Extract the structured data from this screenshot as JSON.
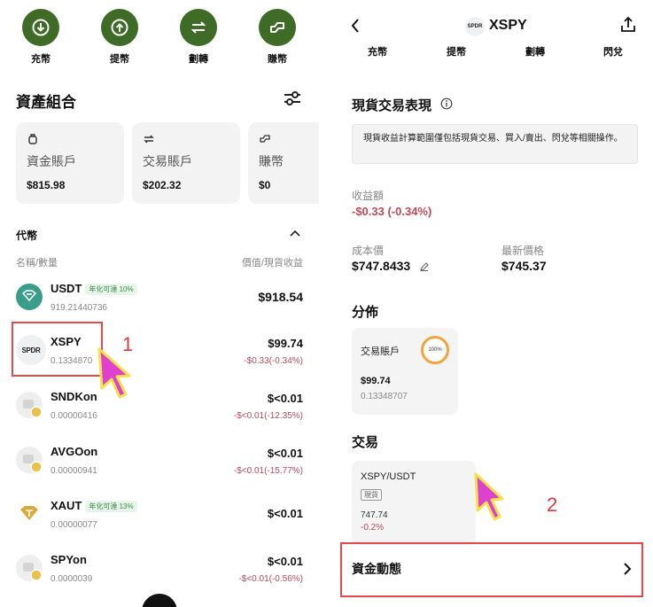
{
  "left": {
    "actions": [
      {
        "label": "充幣",
        "icon": "deposit-icon"
      },
      {
        "label": "提幣",
        "icon": "withdraw-icon"
      },
      {
        "label": "劃轉",
        "icon": "transfer-icon"
      },
      {
        "label": "賺幣",
        "icon": "earn-icon"
      }
    ],
    "portfolio_title": "資產組合",
    "accounts": [
      {
        "name": "資金賬戶",
        "value": "$815.98"
      },
      {
        "name": "交易賬戶",
        "value": "$202.32"
      },
      {
        "name": "賺幣",
        "value": "$0"
      }
    ],
    "tokens_title": "代幣",
    "col_left": "名稱/數量",
    "col_right": "價值/現貨收益",
    "tokens": [
      {
        "name": "USDT",
        "badge": "年化可達 10%",
        "amount": "919.21440736",
        "value": "$918.54",
        "pnl": ""
      },
      {
        "name": "XSPY",
        "badge": "",
        "amount": "0.1334870",
        "value": "$99.74",
        "pnl": "-$0.33(-0.34%)"
      },
      {
        "name": "SNDKon",
        "badge": "",
        "amount": "0.00000416",
        "value": "$<0.01",
        "pnl": "-$<0.01(-12.35%)"
      },
      {
        "name": "AVGOon",
        "badge": "",
        "amount": "0.00000941",
        "value": "$<0.01",
        "pnl": "-$<0.01(-15.77%)"
      },
      {
        "name": "XAUT",
        "badge": "年化可達 13%",
        "amount": "0.00000077",
        "value": "$<0.01",
        "pnl": ""
      },
      {
        "name": "SPYon",
        "badge": "",
        "amount": "0.0000039",
        "value": "$<0.01",
        "pnl": "-$<0.01(-0.56%)"
      }
    ],
    "annotation": "1"
  },
  "right": {
    "title": "XSPY",
    "logo_text": "SPDR",
    "tabs": [
      "充幣",
      "提幣",
      "劃轉",
      "閃兌"
    ],
    "spot_title": "現貨交易表現",
    "info_text": "現貨收益計算範圍僅包括現貨交易、買入/賣出、閃兌等相關操作。",
    "pnl_label": "收益額",
    "pnl_value": "-$0.33 (-0.34%)",
    "cost_label": "成本價",
    "cost_value": "$747.8433",
    "price_label": "最新價格",
    "price_value": "$745.37",
    "dist_title": "分佈",
    "dist_card": {
      "name": "交易賬戶",
      "percent": "100%",
      "value": "$99.74",
      "amount": "0.13348707"
    },
    "trade_title": "交易",
    "trade_card": {
      "pair": "XSPY/USDT",
      "tag": "現貨",
      "price": "747.74",
      "change": "-0.2%"
    },
    "fund_title": "資金動態",
    "annotation": "2"
  },
  "colors": {
    "accent_green": "#3e6b25",
    "negative": "#b94a5c",
    "annotation_red": "#e14a4a",
    "arrow_magenta": "#e040d0"
  }
}
